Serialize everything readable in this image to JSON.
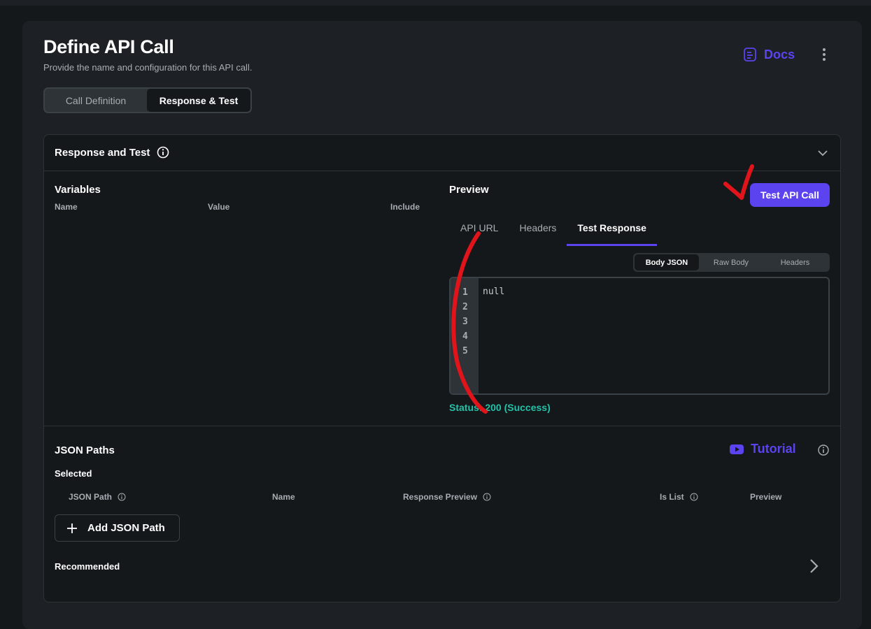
{
  "header": {
    "title": "Define API Call",
    "subtitle": "Provide the name and configuration for this API call.",
    "docs_label": "Docs",
    "docs_icon": "document-icon",
    "more_icon": "more-vertical-icon"
  },
  "mode_tabs": [
    {
      "label": "Call Definition",
      "active": false
    },
    {
      "label": "Response & Test",
      "active": true
    }
  ],
  "card": {
    "title": "Response and Test",
    "title_icon": "info-icon",
    "collapse_icon": "chevron-down-icon"
  },
  "variables": {
    "label": "Variables",
    "columns": [
      "Name",
      "Value",
      "Include"
    ]
  },
  "preview": {
    "label": "Preview",
    "test_button": "Test API Call",
    "tabs": [
      {
        "label": "API URL",
        "active": false
      },
      {
        "label": "Headers",
        "active": false
      },
      {
        "label": "Test Response",
        "active": true
      }
    ],
    "response_views": [
      {
        "label": "Body JSON",
        "active": true
      },
      {
        "label": "Raw Body",
        "active": false
      },
      {
        "label": "Headers",
        "active": false
      }
    ],
    "line_numbers": [
      "1",
      "2",
      "3",
      "4",
      "5"
    ],
    "code": "null",
    "status": "Status: 200 (Success)"
  },
  "json_paths": {
    "label": "JSON Paths",
    "tutorial_label": "Tutorial",
    "tutorial_icon": "youtube-icon",
    "selected_label": "Selected",
    "columns": [
      "JSON Path",
      "Name",
      "Response Preview",
      "Is List",
      "Preview"
    ],
    "add_button": "Add JSON Path",
    "recommended_label": "Recommended"
  },
  "colors": {
    "accent": "#5b43f0",
    "success": "#24c2a8",
    "annotation": "#e0141a"
  }
}
